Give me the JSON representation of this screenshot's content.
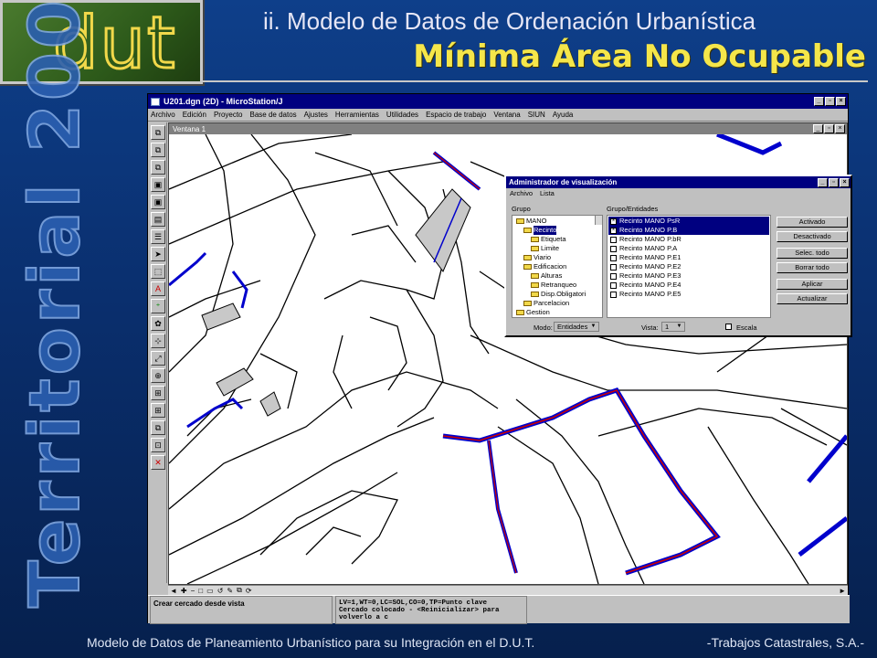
{
  "slide": {
    "logo_text": "dut",
    "title_line1": "ii. Modelo de Datos de Ordenación Urbanística",
    "title_line2": "Mínima Área No Ocupable",
    "vertical_text": "Territorial 2000",
    "footer_left": "Modelo de Datos de Planeamiento Urbanístico para su Integración en el D.U.T.",
    "footer_right": "-Trabajos Catastrales, S.A.-"
  },
  "app": {
    "window_title": "U201.dgn (2D) - MicroStation/J",
    "menu": [
      "Archivo",
      "Edición",
      "Proyecto",
      "Base de datos",
      "Ajustes",
      "Herramientas",
      "Utilidades",
      "Espacio de trabajo",
      "Ventana",
      "SIUN",
      "Ayuda"
    ],
    "view_title": "Ventana 1",
    "status_prompt": "Crear cercado desde vista",
    "status_info_1": "LV=1,WT=0,LC=SOL,CO=0,TP=Punto clave",
    "status_info_2": "Cercado colocado - <Reinicializar> para volverlo a c",
    "accent_blue": "#0000cc",
    "accent_red": "#cc0000"
  },
  "dialog": {
    "title": "Administrador de visualización",
    "menu": [
      "Archivo",
      "Lista"
    ],
    "group_label": "Grupo",
    "entities_label": "Grupo/Entidades",
    "tree": [
      {
        "label": "MANO",
        "indent": 1
      },
      {
        "label": "Recinto",
        "indent": 2,
        "selected": true
      },
      {
        "label": "Etiqueta",
        "indent": 3
      },
      {
        "label": "Limite",
        "indent": 3
      },
      {
        "label": "Viario",
        "indent": 2
      },
      {
        "label": "Edificacion",
        "indent": 2
      },
      {
        "label": "Alturas",
        "indent": 3
      },
      {
        "label": "Retranqueo",
        "indent": 3
      },
      {
        "label": "Disp.Obligatori",
        "indent": 3
      },
      {
        "label": "Parcelacion",
        "indent": 2
      },
      {
        "label": "Gestion",
        "indent": 1
      }
    ],
    "entities": [
      {
        "label": "Recinto MANO PsR",
        "checked": true,
        "selected": true
      },
      {
        "label": "Recinto MANO P.B",
        "checked": true,
        "selected": true
      },
      {
        "label": "Recinto MANO P.bR",
        "checked": false
      },
      {
        "label": "Recinto MANO P.A",
        "checked": false
      },
      {
        "label": "Recinto MANO P.E1",
        "checked": false
      },
      {
        "label": "Recinto MANO P.E2",
        "checked": false
      },
      {
        "label": "Recinto MANO P.E3",
        "checked": false
      },
      {
        "label": "Recinto MANO P.E4",
        "checked": false
      },
      {
        "label": "Recinto MANO P.E5",
        "checked": false
      }
    ],
    "buttons": [
      "Activado",
      "Desactivado",
      "Selec. todo",
      "Borrar todo",
      "Aplicar",
      "Actualizar"
    ],
    "mode_label": "Modo:",
    "mode_value": "Entidades",
    "view_label": "Vista:",
    "view_value": "1",
    "scale_label": "Escala"
  }
}
